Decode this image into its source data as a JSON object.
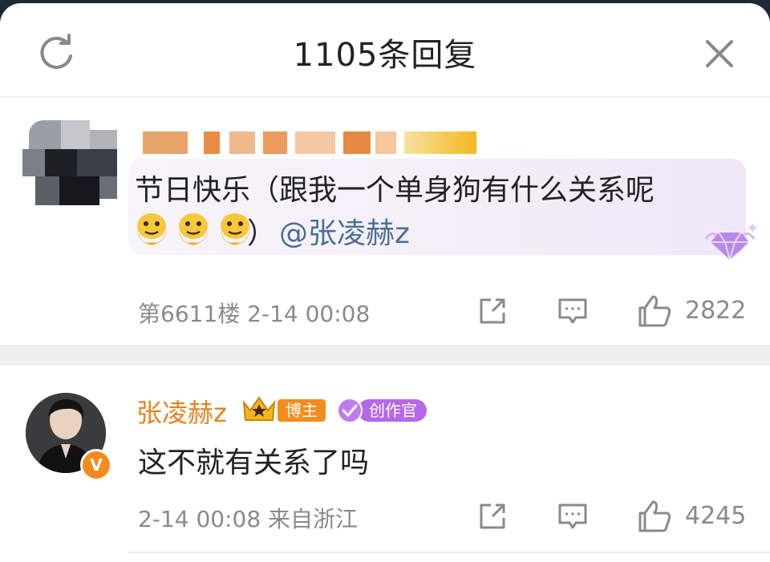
{
  "header": {
    "title": "1105条回复",
    "refresh_icon": "refresh-icon",
    "close_icon": "close-icon"
  },
  "comment1": {
    "content_line1": "节日快乐（跟我一个单身狗有什么关系呢",
    "content_paren": "）",
    "mention": "@张凌赫z",
    "emoji": "melting-face-emoji",
    "floor_time": "第6611楼 2-14 00:08",
    "like_count": "2822",
    "actions": [
      "share-icon",
      "comment-icon",
      "like-icon"
    ]
  },
  "comment2": {
    "author": "张凌赫z",
    "tag_host": "博主",
    "tag_creator": "创作官",
    "verified": "V",
    "content": "这不就有关系了吗",
    "meta": "2-14 00:08  来自浙江",
    "like_count": "4245",
    "actions": [
      "share-icon",
      "comment-icon",
      "like-icon"
    ]
  },
  "colors": {
    "author_name": "#e8821e",
    "mention": "#4a6e9a",
    "host_tag": "#f58c1e",
    "creator_tag": "#b568e8"
  }
}
